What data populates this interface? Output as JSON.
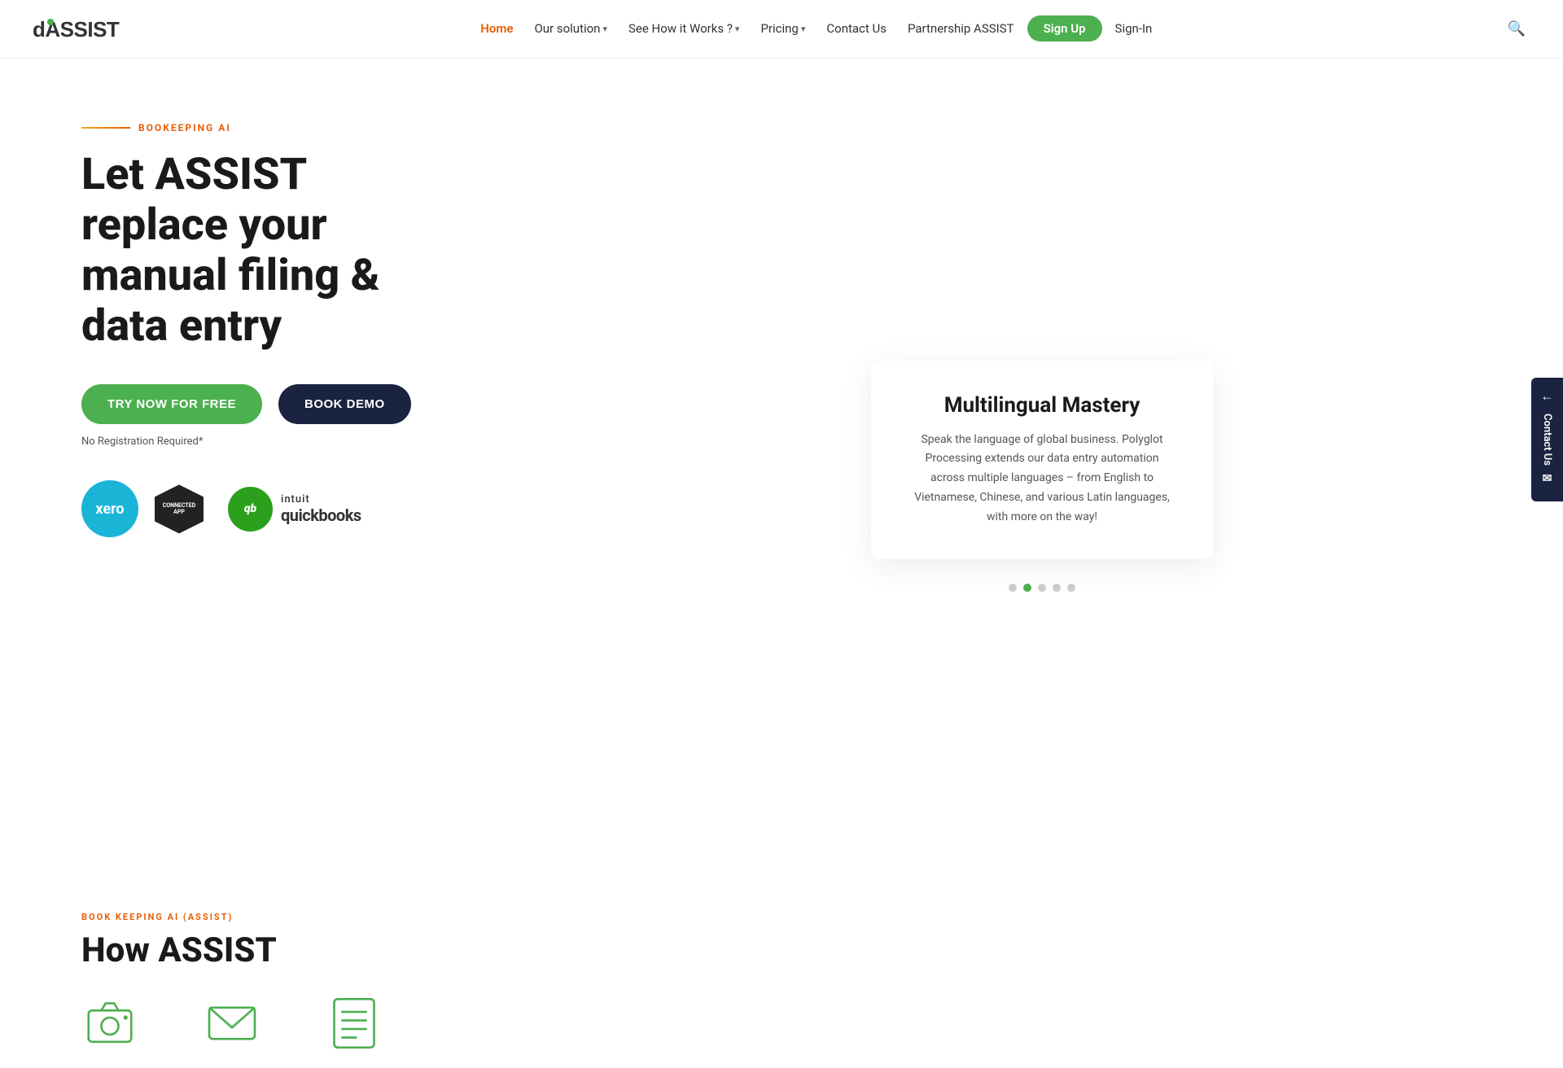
{
  "logo": {
    "text": "ASSIST",
    "prefix": "d"
  },
  "nav": {
    "links": [
      {
        "label": "Home",
        "active": true,
        "hasDropdown": false
      },
      {
        "label": "Our solution",
        "active": false,
        "hasDropdown": true
      },
      {
        "label": "See How it Works ?",
        "active": false,
        "hasDropdown": true
      },
      {
        "label": "Pricing",
        "active": false,
        "hasDropdown": true
      },
      {
        "label": "Contact Us",
        "active": false,
        "hasDropdown": false
      },
      {
        "label": "Partnership ASSIST",
        "active": false,
        "hasDropdown": false
      }
    ],
    "signup_label": "Sign Up",
    "signin_label": "Sign-In"
  },
  "hero": {
    "badge": "BOOKEEPING AI",
    "title_line1": "Let ASSIST",
    "title_line2": "replace your",
    "title_line3": "manual filing &",
    "title_line4": "data entry",
    "btn_try": "TRY NOW FOR FREE",
    "btn_demo": "BOOK DEMO",
    "no_reg": "No Registration Required*"
  },
  "card": {
    "title": "Multilingual Mastery",
    "description": "Speak the language of global business. Polyglot Processing extends our data entry automation across multiple languages – from English to Vietnamese, Chinese, and various Latin languages, with more on the way!"
  },
  "slider": {
    "dots": [
      false,
      true,
      true,
      true,
      true
    ],
    "active": 1
  },
  "xero": {
    "label": "xero",
    "connected_line1": "CONNECTED",
    "connected_line2": "APP"
  },
  "quickbooks": {
    "symbol": "qb",
    "intuit": "intuit",
    "name": "quickbooks"
  },
  "sidebar": {
    "arrow": "→",
    "contact_label": "Contact Us",
    "envelope": "✉"
  },
  "bottom": {
    "section_label": "BOOK KEEPING AI (ASSIST)",
    "section_title_part1": "How ASSIST"
  }
}
